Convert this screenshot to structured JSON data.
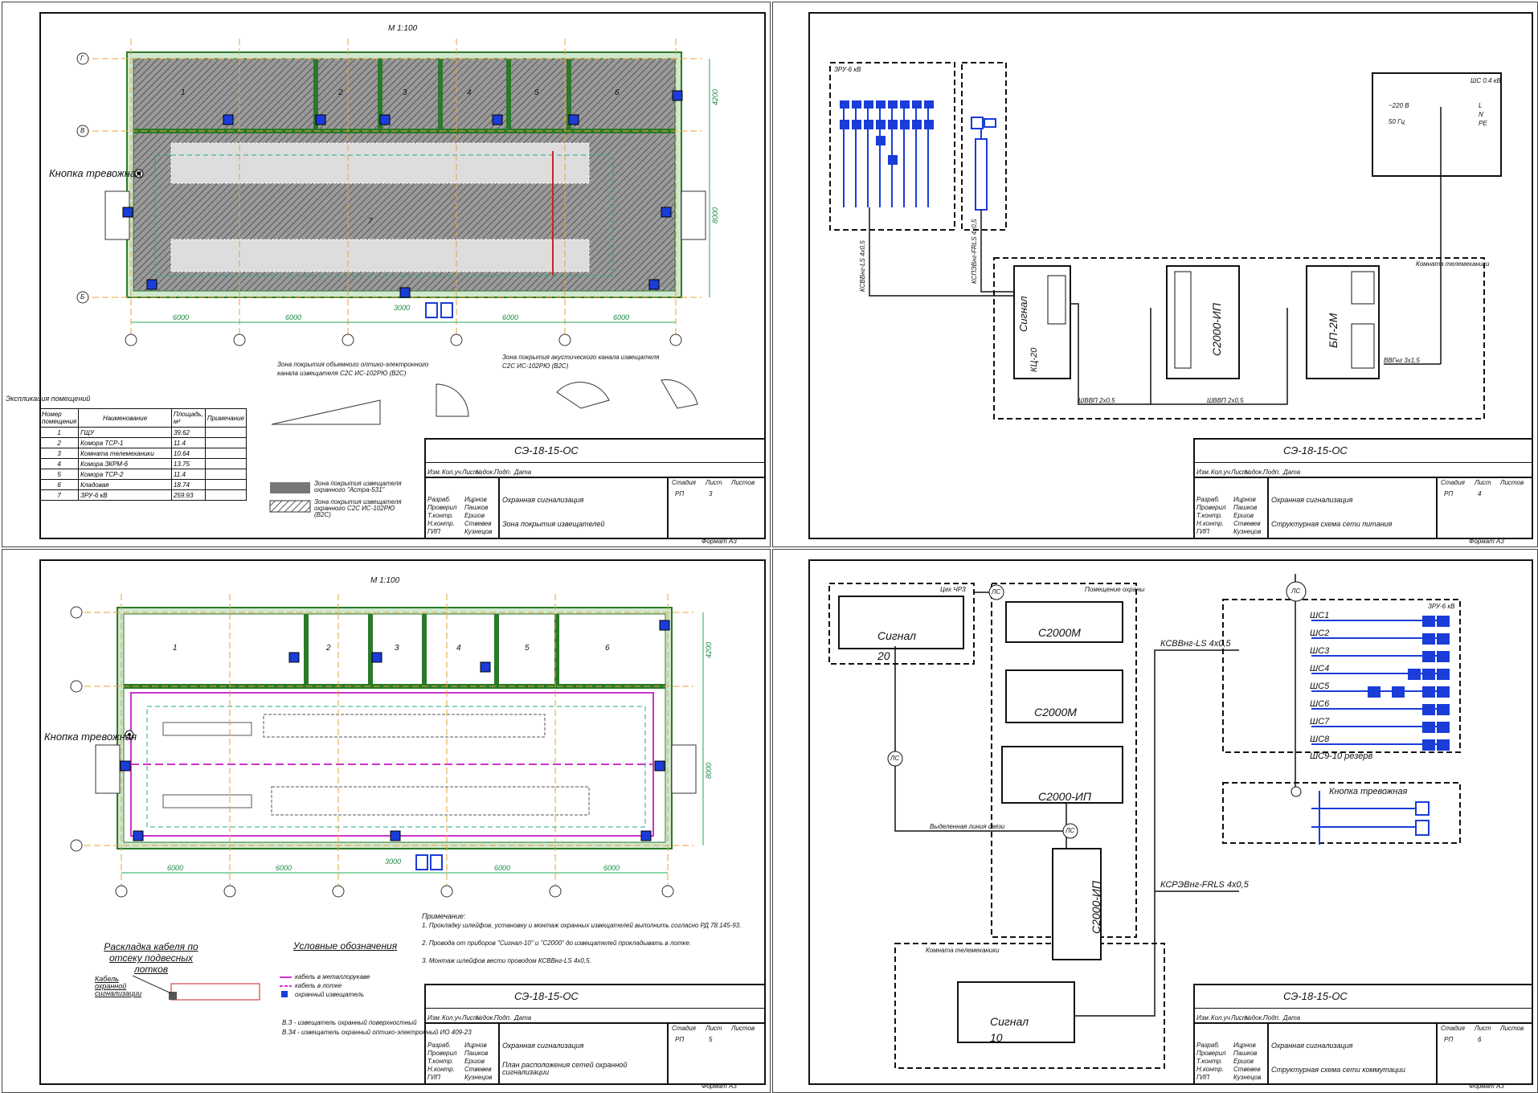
{
  "sheet1": {
    "scale": "М 1:100",
    "alarm_button": "Кнопка тревожная",
    "axes_left": [
      "Г",
      "В",
      "Б"
    ],
    "dims_bottom": [
      "6000",
      "6000",
      "3000",
      "6000",
      "6000"
    ],
    "dims_right": [
      "4200",
      "8000"
    ],
    "rooms": [
      "1",
      "2",
      "3",
      "4",
      "5",
      "6",
      "7"
    ],
    "coverage_title_1": "Зона покрытия объемного оптико-электронного канала извещателя С2С ИС-102РЮ (В2С)",
    "coverage_title_2": "Зона покрытия акустического канала извещателя С2С ИС-102РЮ (В2С)",
    "explication_title": "Экспликация помещений",
    "explication_headers": [
      "Номер помещения",
      "Наименование",
      "Площадь, м²",
      "Примечание"
    ],
    "explication_rows": [
      [
        "1",
        "ГЩУ",
        "39.62",
        ""
      ],
      [
        "2",
        "Комора ТСР-1",
        "11.4",
        ""
      ],
      [
        "3",
        "Комната телемеханики",
        "10.64",
        ""
      ],
      [
        "4",
        "Комора ЗКРМ-6",
        "13.75",
        ""
      ],
      [
        "5",
        "Комора ТСР-2",
        "11.4",
        ""
      ],
      [
        "6",
        "Кладовая",
        "18.74",
        ""
      ],
      [
        "7",
        "ЗРУ-6 кВ",
        "259.93",
        ""
      ]
    ],
    "legend": [
      "Зона покрытия извещателя охранного \"Астра-531\"",
      "Зона покрытия извещателя охранного С2С ИС-102РЮ (В2С)"
    ],
    "code": "СЭ-18-15-ОС",
    "title_rows": [
      [
        "Разраб.",
        "Ицрнов"
      ],
      [
        "Проверил",
        "Пашков"
      ],
      [
        "Т.контр.",
        "Ершов"
      ],
      [
        "Н.контр.",
        "Ствевев"
      ],
      [
        "ГИП",
        "Кузнецов"
      ]
    ],
    "header_cells": [
      "Изм.",
      "Кол.уч",
      "Лист",
      "№док.",
      "Подп.",
      "Дата"
    ],
    "doc_title": "Охранная сигнализация",
    "sheet_title": "Зона покрытия извещателей",
    "stage_labels": [
      "Стадия",
      "Лист",
      "Листов"
    ],
    "stage_values": [
      "РП",
      "3",
      ""
    ],
    "format": "Формат А3"
  },
  "sheet2": {
    "zru_label": "ЗРУ-6 кВ",
    "shs_label": "ШС 0.4 кВ",
    "shs_lines": [
      "~220 В",
      "50 Гц",
      "L",
      "N",
      "PE"
    ],
    "tele_room": "Комната телемеханики",
    "dev1": "Сигнал",
    "dev1_sub": "КЦ-20",
    "dev2": "С2000-ИП",
    "dev3": "БП-2М",
    "cable1": "КСВВнг-LS 4х0,5",
    "cable2": "КСПЭВнг-FRLS 4х0,5",
    "cable3": "ШВВП 2х0,5",
    "cable4": "ВВГнг 3х1,5",
    "code": "СЭ-18-15-ОС",
    "doc_title": "Охранная сигнализация",
    "sheet_title": "Структурная схема сети питания",
    "stage_values": [
      "РП",
      "4",
      ""
    ],
    "format": "Формат А3"
  },
  "sheet3": {
    "scale": "М 1:100",
    "alarm_button": "Кнопка тревожная",
    "dims_bottom": [
      "6000",
      "6000",
      "3000",
      "6000",
      "6000"
    ],
    "dims_right": [
      "4200",
      "8000"
    ],
    "rooms": [
      "1",
      "2",
      "3",
      "4",
      "5",
      "6"
    ],
    "cable_layout_title": "Раскладка кабеля по отсеку подвесных лотков",
    "cable_label": "Кабель охранной сигнализации",
    "legend_title": "Условные обозначения",
    "legend_items": [
      "кабель в металлорукаве",
      "кабель в лотке",
      "охранный извещатель"
    ],
    "notes_title": "Примечание:",
    "notes": [
      "1. Прокладку шлейфов, установку и монтаж охранных извещателей выполнить согласно РД 78.145-93.",
      "2. Провода от приборов \"Сигнал-10\" и \"С2000\" до извещателей прокладывать в лотке.",
      "3. Монтаж шлейфов вести проводом КСВВнг-LS 4х0,5."
    ],
    "device_notes": [
      "В.З - извещатель охранный поверхностный",
      "В.З4 - извещатель охранный оптико-электронный ИО 409-23"
    ],
    "code": "СЭ-18-15-ОС",
    "doc_title": "Охранная сигнализация",
    "sheet_title": "План расположения сетей охранной сигнализации",
    "stage_values": [
      "РП",
      "5",
      ""
    ],
    "format": "Формат А3"
  },
  "sheet4": {
    "cab_label": "Цех ЧРЗ",
    "security_room": "Помещение охраны",
    "tele_room": "Комната телемеханики",
    "dev_signal20": "Сигнал",
    "dev_signal20_num": "20",
    "dev_c2000m_1": "С2000М",
    "dev_c2000m_2": "С2000М",
    "dev_c2000ip_1": "С2000-ИП",
    "dev_c2000ip_2": "С2000-ИП",
    "dev_signal10": "Сигнал",
    "dev_signal10_num": "10",
    "ls_label": "ЛС",
    "line_label": "Выделенная линия связи",
    "cable1": "КСВВнг-LS 4х0,5",
    "cable2": "КСРЭВнг-FRLS 4х0,5",
    "zru_label": "ЗРУ-6 кВ",
    "loops": [
      "ШС1",
      "ШС2",
      "ШС3",
      "ШС4",
      "ШС5",
      "ШС6",
      "ШС7",
      "ШС8",
      "ШС9-10 резерв"
    ],
    "alarm_button": "Кнопка тревожная",
    "code": "СЭ-18-15-ОС",
    "doc_title": "Охранная сигнализация",
    "sheet_title": "Структурная схема сети коммутации",
    "stage_values": [
      "РП",
      "6",
      ""
    ],
    "format": "Формат А3"
  }
}
